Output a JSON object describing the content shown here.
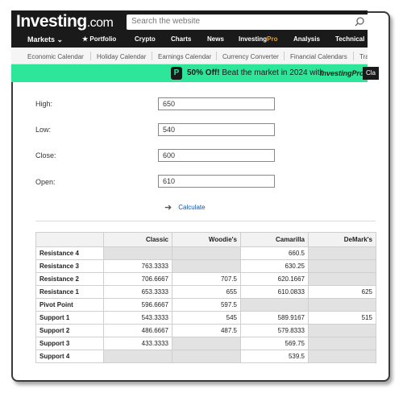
{
  "header": {
    "logo_main": "Investing",
    "logo_suffix": ".com",
    "search_placeholder": "Search the website"
  },
  "main_nav": [
    {
      "label": "Markets ⌄"
    },
    {
      "label": "★ Portfolio"
    },
    {
      "label": "Crypto"
    },
    {
      "label": "Charts"
    },
    {
      "label": "News"
    },
    {
      "label_a": "Investing",
      "label_b": "Pro"
    },
    {
      "label": "Analysis"
    },
    {
      "label": "Technical"
    }
  ],
  "sub_nav": [
    "Economic Calendar",
    "Holiday Calendar",
    "Earnings Calendar",
    "Currency Converter",
    "Financial Calendars",
    "Tradin"
  ],
  "banner": {
    "badge": "P",
    "offer": "50% Off!",
    "text": " Beat the market in 2024 with",
    "brand": "InvestingPro",
    "cta": "Cla"
  },
  "form": {
    "high_label": "High:",
    "high_value": "650",
    "low_label": "Low:",
    "low_value": "540",
    "close_label": "Close:",
    "close_value": "600",
    "open_label": "Open:",
    "open_value": "610",
    "calculate": "Calculate"
  },
  "table": {
    "columns": [
      "",
      "Classic",
      "Woodie's",
      "Camarilla",
      "DeMark's"
    ],
    "rows": [
      {
        "label": "Resistance 4",
        "classic": "",
        "woodie": "",
        "camarilla": "660.5",
        "demark": ""
      },
      {
        "label": "Resistance 3",
        "classic": "763.3333",
        "woodie": "",
        "camarilla": "630.25",
        "demark": ""
      },
      {
        "label": "Resistance 2",
        "classic": "706.6667",
        "woodie": "707.5",
        "camarilla": "620.1667",
        "demark": ""
      },
      {
        "label": "Resistance 1",
        "classic": "653.3333",
        "woodie": "655",
        "camarilla": "610.0833",
        "demark": "625"
      },
      {
        "label": "Pivot Point",
        "classic": "596.6667",
        "woodie": "597.5",
        "camarilla": "",
        "demark": ""
      },
      {
        "label": "Support 1",
        "classic": "543.3333",
        "woodie": "545",
        "camarilla": "589.9167",
        "demark": "515"
      },
      {
        "label": "Support 2",
        "classic": "486.6667",
        "woodie": "487.5",
        "camarilla": "579.8333",
        "demark": ""
      },
      {
        "label": "Support 3",
        "classic": "433.3333",
        "woodie": "",
        "camarilla": "569.75",
        "demark": ""
      },
      {
        "label": "Support 4",
        "classic": "",
        "woodie": "",
        "camarilla": "539.5",
        "demark": ""
      }
    ]
  }
}
